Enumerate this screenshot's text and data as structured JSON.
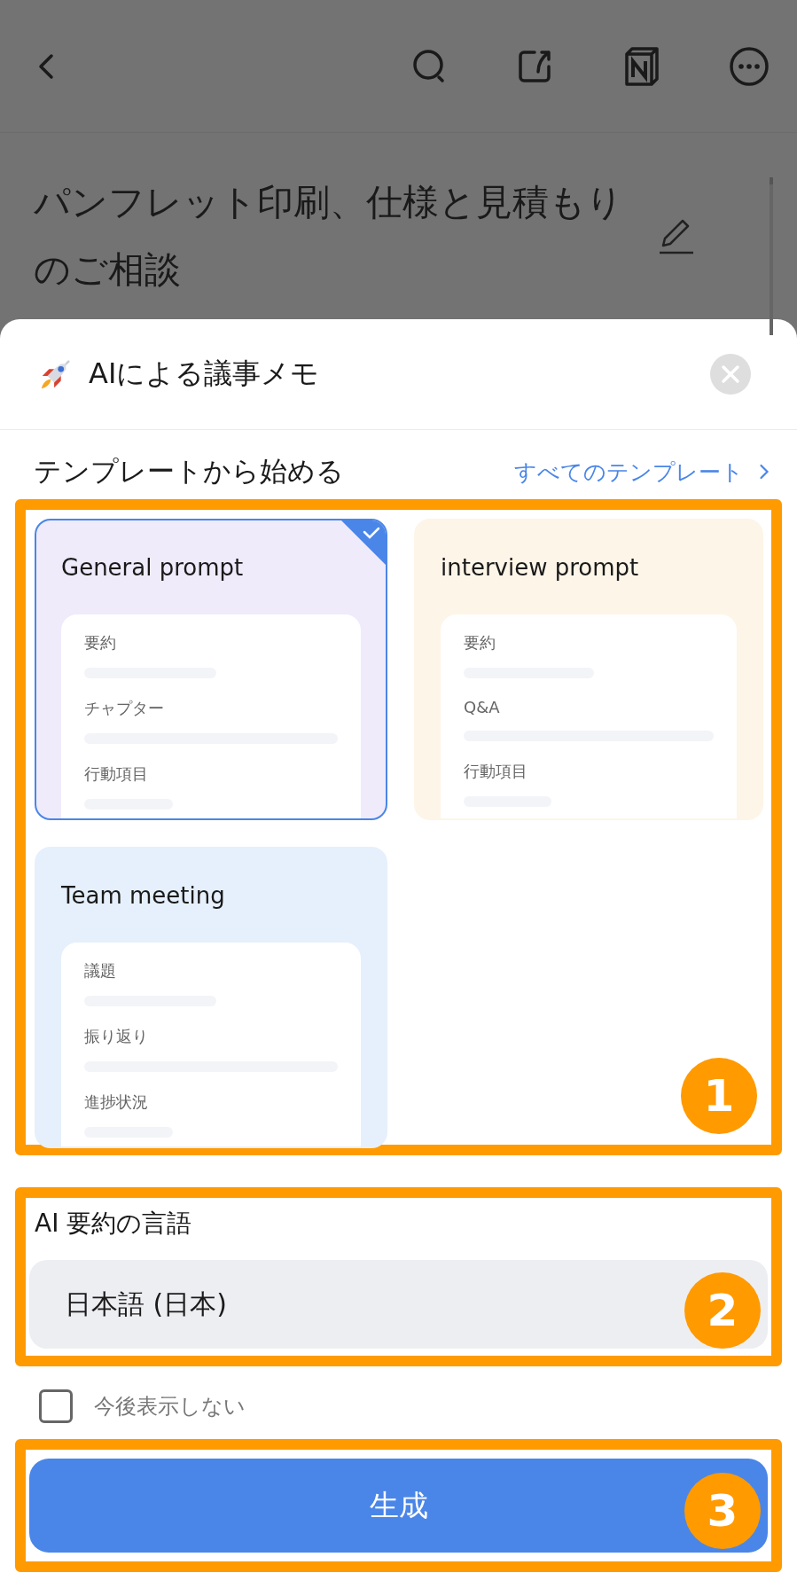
{
  "note": {
    "title": "パンフレット印刷、仕様と見積もりのご相談"
  },
  "sheet": {
    "title": "AIによる議事メモ",
    "section_title": "テンプレートから始める",
    "all_templates_link": "すべてのテンプレート",
    "templates": [
      {
        "name": "General prompt",
        "selected": true,
        "color": "#efebfb",
        "sections": [
          "要約",
          "チャプター",
          "行動項目"
        ]
      },
      {
        "name": "interview prompt",
        "selected": false,
        "color": "#fdf5e8",
        "sections": [
          "要約",
          "Q&A",
          "行動項目"
        ]
      },
      {
        "name": "Team meeting",
        "selected": false,
        "color": "#e6f0fc",
        "sections": [
          "議題",
          "振り返り",
          "進捗状況"
        ]
      }
    ],
    "language_label": "AI 要約の言語",
    "language_value": "日本語 (日本)",
    "dont_show_again": {
      "label": "今後表示しない",
      "checked": false
    },
    "generate_button": "生成"
  },
  "annotations": [
    "1",
    "2",
    "3"
  ]
}
